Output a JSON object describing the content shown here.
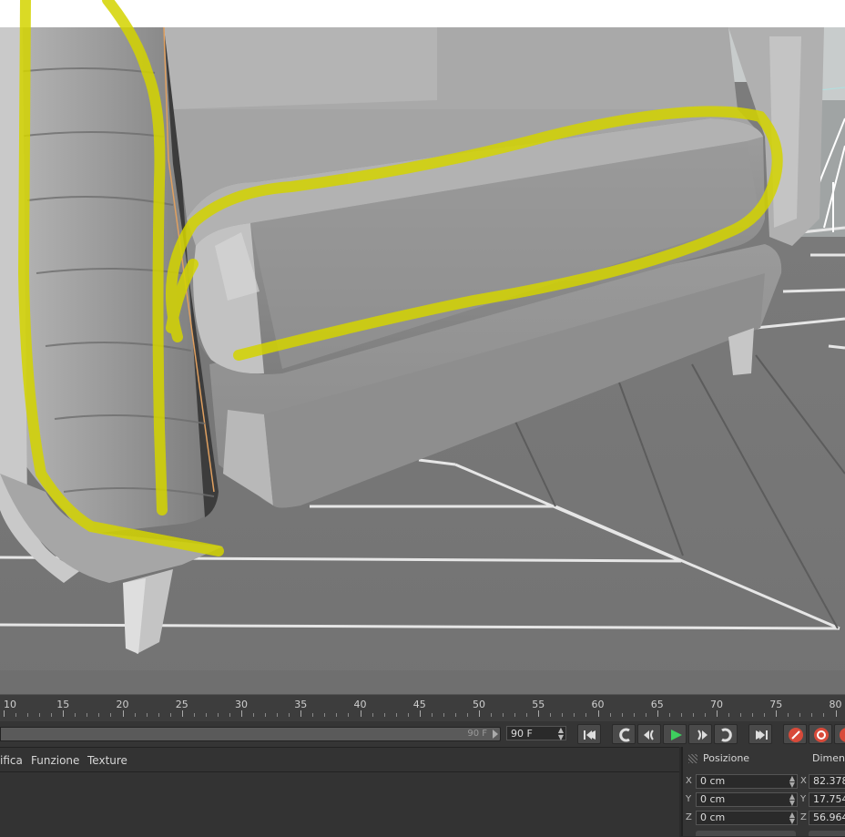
{
  "timeline": {
    "ticks": [
      "10",
      "15",
      "20",
      "25",
      "30",
      "35",
      "40",
      "45",
      "50",
      "55",
      "60",
      "65",
      "70",
      "75",
      "80"
    ]
  },
  "transport": {
    "range_end_label": "90 F",
    "current_frame": "90 F",
    "buttons": [
      "go-to-start-icon",
      "previous-key-icon",
      "step-back-icon",
      "play-icon",
      "step-forward-icon",
      "next-key-icon",
      "go-to-end-icon",
      "record-icon",
      "auto-key-icon",
      "key-selection-icon"
    ],
    "colors": {
      "play": "#3ecf5e",
      "record": "#d84a3a"
    }
  },
  "attributes": {
    "menu": [
      "ifica",
      "Funzione",
      "Texture"
    ]
  },
  "coordinates": {
    "position_title": "Posizione",
    "size_title": "Dimens",
    "position": [
      {
        "axis": "X",
        "value": "0 cm"
      },
      {
        "axis": "Y",
        "value": "0 cm"
      },
      {
        "axis": "Z",
        "value": "0 cm"
      }
    ],
    "size": [
      {
        "axis": "X",
        "value": "82.378"
      },
      {
        "axis": "Y",
        "value": "17.754"
      },
      {
        "axis": "Z",
        "value": "56.964"
      }
    ]
  },
  "viewport": {
    "selection_color": "#d4d400",
    "object_outline_color": "#e0a060"
  }
}
